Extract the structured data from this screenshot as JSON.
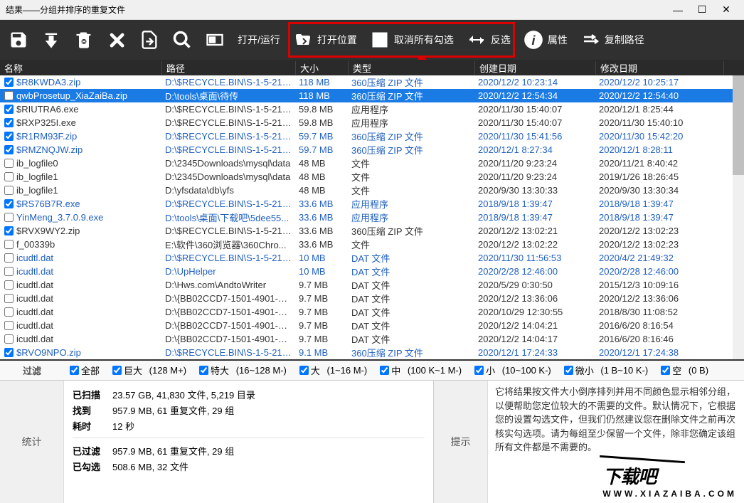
{
  "window": {
    "title": "结果——分组并排序的重复文件"
  },
  "toolbar": {
    "open_run": "打开/运行",
    "open_location": "打开位置",
    "uncheck_all": "取消所有勾选",
    "invert": "反选",
    "properties": "属性",
    "copy_path": "复制路径"
  },
  "columns": {
    "name": "名称",
    "path": "路径",
    "size": "大小",
    "type": "类型",
    "created": "创建日期",
    "modified": "修改日期"
  },
  "rows": [
    {
      "chk": true,
      "alt": false,
      "name": "$R8KWDA3.zip",
      "path": "D:\\$RECYCLE.BIN\\S-1-5-21-21...",
      "size": "118 MB",
      "type": "360压缩 ZIP 文件",
      "created": "2020/12/2 10:23:14",
      "modified": "2020/12/2 10:25:17"
    },
    {
      "chk": false,
      "sel": true,
      "name": "qwbProsetup_XiaZaiBa.zip",
      "path": "D:\\tools\\桌面\\待传",
      "size": "118 MB",
      "type": "360压缩 ZIP 文件",
      "created": "2020/12/2 12:54:34",
      "modified": "2020/12/2 12:54:40"
    },
    {
      "chk": true,
      "alt": true,
      "name": "$RIUTRA6.exe",
      "path": "D:\\$RECYCLE.BIN\\S-1-5-21-21...",
      "size": "59.8 MB",
      "type": "应用程序",
      "created": "2020/11/30 15:40:07",
      "modified": "2020/12/1 8:25:44"
    },
    {
      "chk": true,
      "alt": true,
      "name": "$RXP325I.exe",
      "path": "D:\\$RECYCLE.BIN\\S-1-5-21-21...",
      "size": "59.8 MB",
      "type": "应用程序",
      "created": "2020/11/30 15:40:07",
      "modified": "2020/11/30 15:40:10"
    },
    {
      "chk": true,
      "alt": false,
      "name": "$R1RM93F.zip",
      "path": "D:\\$RECYCLE.BIN\\S-1-5-21-21...",
      "size": "59.7 MB",
      "type": "360压缩 ZIP 文件",
      "created": "2020/11/30 15:41:56",
      "modified": "2020/11/30 15:42:20"
    },
    {
      "chk": true,
      "alt": false,
      "name": "$RMZNQJW.zip",
      "path": "D:\\$RECYCLE.BIN\\S-1-5-21-21...",
      "size": "59.7 MB",
      "type": "360压缩 ZIP 文件",
      "created": "2020/12/1 8:27:34",
      "modified": "2020/12/1 8:28:11"
    },
    {
      "chk": false,
      "alt": true,
      "name": "ib_logfile0",
      "path": "D:\\2345Downloads\\mysql\\data",
      "size": "48 MB",
      "type": "文件",
      "created": "2020/11/20 9:23:24",
      "modified": "2020/11/21 8:40:42"
    },
    {
      "chk": false,
      "alt": true,
      "name": "ib_logfile1",
      "path": "D:\\2345Downloads\\mysql\\data",
      "size": "48 MB",
      "type": "文件",
      "created": "2020/11/20 9:23:24",
      "modified": "2019/1/26 18:26:45"
    },
    {
      "chk": false,
      "alt": true,
      "name": "ib_logfile1",
      "path": "D:\\yfsdata\\db\\yfs",
      "size": "48 MB",
      "type": "文件",
      "created": "2020/9/30 13:30:33",
      "modified": "2020/9/30 13:30:34"
    },
    {
      "chk": true,
      "alt": false,
      "name": "$RS76B7R.exe",
      "path": "D:\\$RECYCLE.BIN\\S-1-5-21-21...",
      "size": "33.6 MB",
      "type": "应用程序",
      "created": "2018/9/18 1:39:47",
      "modified": "2018/9/18 1:39:47"
    },
    {
      "chk": false,
      "alt": false,
      "name": "YinMeng_3.7.0.9.exe",
      "path": "D:\\tools\\桌面\\下载吧\\5dee55...",
      "size": "33.6 MB",
      "type": "应用程序",
      "created": "2018/9/18 1:39:47",
      "modified": "2018/9/18 1:39:47"
    },
    {
      "chk": true,
      "alt": true,
      "name": "$RVX9WY2.zip",
      "path": "D:\\$RECYCLE.BIN\\S-1-5-21-21...",
      "size": "33.6 MB",
      "type": "360压缩 ZIP 文件",
      "created": "2020/12/2 13:02:21",
      "modified": "2020/12/2 13:02:23"
    },
    {
      "chk": false,
      "alt": true,
      "name": "f_00339b",
      "path": "E:\\软件\\360浏览器\\360Chro...",
      "size": "33.6 MB",
      "type": "文件",
      "created": "2020/12/2 13:02:22",
      "modified": "2020/12/2 13:02:23"
    },
    {
      "chk": false,
      "alt": false,
      "name": "icudtl.dat",
      "path": "D:\\$RECYCLE.BIN\\S-1-5-21-21...",
      "size": "10 MB",
      "type": "DAT 文件",
      "created": "2020/11/30 11:56:53",
      "modified": "2020/4/2 21:49:32"
    },
    {
      "chk": false,
      "alt": false,
      "name": "icudtl.dat",
      "path": "D:\\UpHelper",
      "size": "10 MB",
      "type": "DAT 文件",
      "created": "2020/2/28 12:46:00",
      "modified": "2020/2/28 12:46:00"
    },
    {
      "chk": false,
      "alt": true,
      "name": "icudtl.dat",
      "path": "D:\\Hws.com\\AndtoWriter",
      "size": "9.7 MB",
      "type": "DAT 文件",
      "created": "2020/5/29 0:30:50",
      "modified": "2015/12/3 10:09:16"
    },
    {
      "chk": false,
      "alt": true,
      "name": "icudtl.dat",
      "path": "D:\\{BB02CCD7-1501-4901-B5E...",
      "size": "9.7 MB",
      "type": "DAT 文件",
      "created": "2020/12/2 13:36:06",
      "modified": "2020/12/2 13:36:06"
    },
    {
      "chk": false,
      "alt": true,
      "name": "icudtl.dat",
      "path": "D:\\{BB02CCD7-1501-4901-B5E...",
      "size": "9.7 MB",
      "type": "DAT 文件",
      "created": "2020/10/29 12:30:55",
      "modified": "2018/8/30 11:08:52"
    },
    {
      "chk": false,
      "alt": true,
      "name": "icudtl.dat",
      "path": "D:\\{BB02CCD7-1501-4901-B5E...",
      "size": "9.7 MB",
      "type": "DAT 文件",
      "created": "2020/12/2 14:04:21",
      "modified": "2016/6/20 8:16:54"
    },
    {
      "chk": false,
      "alt": true,
      "name": "icudtl.dat",
      "path": "D:\\{BB02CCD7-1501-4901-B5E...",
      "size": "9.7 MB",
      "type": "DAT 文件",
      "created": "2020/12/2 14:04:17",
      "modified": "2016/6/20 8:16:46"
    },
    {
      "chk": true,
      "alt": false,
      "name": "$RVO9NPO.zip",
      "path": "D:\\$RECYCLE.BIN\\S-1-5-21-21...",
      "size": "9.1 MB",
      "type": "360压缩 ZIP 文件",
      "created": "2020/12/1 17:24:33",
      "modified": "2020/12/1 17:24:38"
    }
  ],
  "filters": {
    "label": "过滤",
    "all": "全部",
    "huge": "巨大",
    "huge_range": "(128 M+)",
    "xlarge": "特大",
    "xlarge_range": "(16~128 M-)",
    "large": "大",
    "large_range": "(1~16 M-)",
    "medium": "中",
    "medium_range": "(100 K~1 M-)",
    "small": "小",
    "small_range": "(10~100 K-)",
    "tiny": "微小",
    "tiny_range": "(1 B~10 K-)",
    "empty": "空",
    "empty_range": "(0 B)"
  },
  "stats": {
    "label": "统计",
    "scanned_key": "已扫描",
    "scanned_val": "23.57 GB, 41,830 文件, 5,219 目录",
    "found_key": "找到",
    "found_val": "957.9 MB, 61 重复文件, 29 组",
    "time_key": "耗时",
    "time_val": "12 秒",
    "filtered_key": "已过滤",
    "filtered_val": "957.9 MB, 61 重复文件, 29 组",
    "checked_key": "已勾选",
    "checked_val": "508.6 MB, 32 文件"
  },
  "tips": {
    "label": "提示",
    "text": "它将结果按文件大小倒序排列并用不同颜色显示相邻分组，以便帮助您定位较大的不需要的文件。默认情况下，它根据您的设置勾选文件，但我们仍然建议您在删除文件之前再次核实勾选项。请为每组至少保留一个文件，除非您确定该组所有文件都是不需要的。"
  },
  "watermark": {
    "main": "下载吧",
    "sub": "WWW.XIAZAIBA.COM"
  }
}
